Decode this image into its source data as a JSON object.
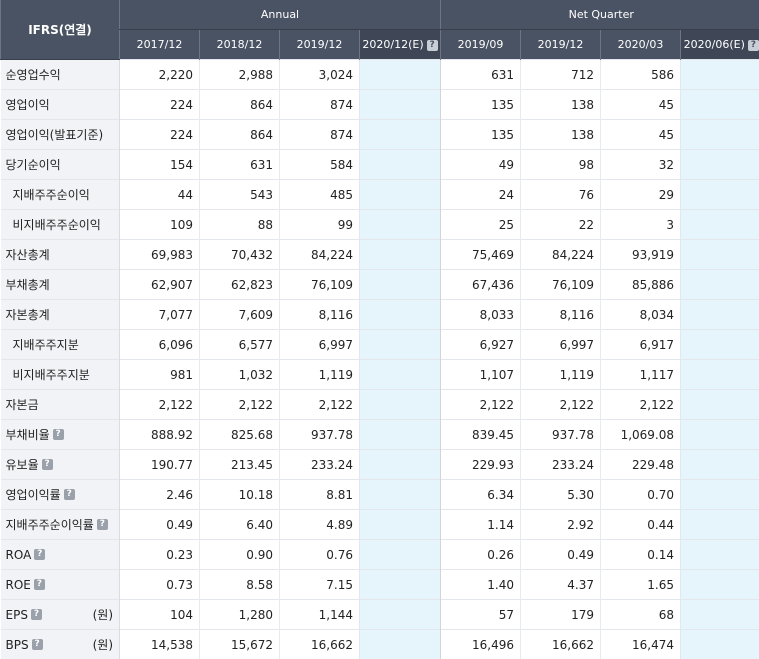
{
  "header": {
    "ifrs_label": "IFRS(연결)",
    "annual_label": "Annual",
    "quarter_label": "Net Quarter",
    "annual_periods": [
      "2017/12",
      "2018/12",
      "2019/12"
    ],
    "annual_estimate": "2020/12(E)",
    "quarter_periods": [
      "2019/09",
      "2019/12",
      "2020/03"
    ],
    "quarter_estimate": "2020/06(E)",
    "help_glyph": "?"
  },
  "rows": [
    {
      "label": "순영업수익",
      "annual": [
        "2,220",
        "2,988",
        "3,024"
      ],
      "quarter": [
        "631",
        "712",
        "586"
      ]
    },
    {
      "label": "영업이익",
      "annual": [
        "224",
        "864",
        "874"
      ],
      "quarter": [
        "135",
        "138",
        "45"
      ]
    },
    {
      "label": "영업이익(발표기준)",
      "annual": [
        "224",
        "864",
        "874"
      ],
      "quarter": [
        "135",
        "138",
        "45"
      ]
    },
    {
      "label": "당기순이익",
      "annual": [
        "154",
        "631",
        "584"
      ],
      "quarter": [
        "49",
        "98",
        "32"
      ]
    },
    {
      "label": "지배주주순이익",
      "annual": [
        "44",
        "543",
        "485"
      ],
      "quarter": [
        "24",
        "76",
        "29"
      ]
    },
    {
      "label": "비지배주주순이익",
      "annual": [
        "109",
        "88",
        "99"
      ],
      "quarter": [
        "25",
        "22",
        "3"
      ]
    },
    {
      "label": "자산총계",
      "annual": [
        "69,983",
        "70,432",
        "84,224"
      ],
      "quarter": [
        "75,469",
        "84,224",
        "93,919"
      ]
    },
    {
      "label": "부채총계",
      "annual": [
        "62,907",
        "62,823",
        "76,109"
      ],
      "quarter": [
        "67,436",
        "76,109",
        "85,886"
      ]
    },
    {
      "label": "자본총계",
      "annual": [
        "7,077",
        "7,609",
        "8,116"
      ],
      "quarter": [
        "8,033",
        "8,116",
        "8,034"
      ]
    },
    {
      "label": "지배주주지분",
      "annual": [
        "6,096",
        "6,577",
        "6,997"
      ],
      "quarter": [
        "6,927",
        "6,997",
        "6,917"
      ]
    },
    {
      "label": "비지배주주지분",
      "annual": [
        "981",
        "1,032",
        "1,119"
      ],
      "quarter": [
        "1,107",
        "1,119",
        "1,117"
      ]
    },
    {
      "label": "자본금",
      "annual": [
        "2,122",
        "2,122",
        "2,122"
      ],
      "quarter": [
        "2,122",
        "2,122",
        "2,122"
      ]
    },
    {
      "label": "부채비율",
      "annual": [
        "888.92",
        "825.68",
        "937.78"
      ],
      "quarter": [
        "839.45",
        "937.78",
        "1,069.08"
      ]
    },
    {
      "label": "유보율",
      "annual": [
        "190.77",
        "213.45",
        "233.24"
      ],
      "quarter": [
        "229.93",
        "233.24",
        "229.48"
      ]
    },
    {
      "label": "영업이익률",
      "annual": [
        "2.46",
        "10.18",
        "8.81"
      ],
      "quarter": [
        "6.34",
        "5.30",
        "0.70"
      ]
    },
    {
      "label": "지배주주순이익률",
      "annual": [
        "0.49",
        "6.40",
        "4.89"
      ],
      "quarter": [
        "1.14",
        "2.92",
        "0.44"
      ]
    },
    {
      "label": "ROA",
      "annual": [
        "0.23",
        "0.90",
        "0.76"
      ],
      "quarter": [
        "0.26",
        "0.49",
        "0.14"
      ]
    },
    {
      "label": "ROE",
      "annual": [
        "0.73",
        "8.58",
        "7.15"
      ],
      "quarter": [
        "1.40",
        "4.37",
        "1.65"
      ]
    },
    {
      "label": "EPS",
      "unit": "(원)",
      "annual": [
        "104",
        "1,280",
        "1,144"
      ],
      "quarter": [
        "57",
        "179",
        "68"
      ]
    },
    {
      "label": "BPS",
      "unit": "(원)",
      "annual": [
        "14,538",
        "15,672",
        "16,662"
      ],
      "quarter": [
        "16,496",
        "16,662",
        "16,474"
      ]
    }
  ]
}
